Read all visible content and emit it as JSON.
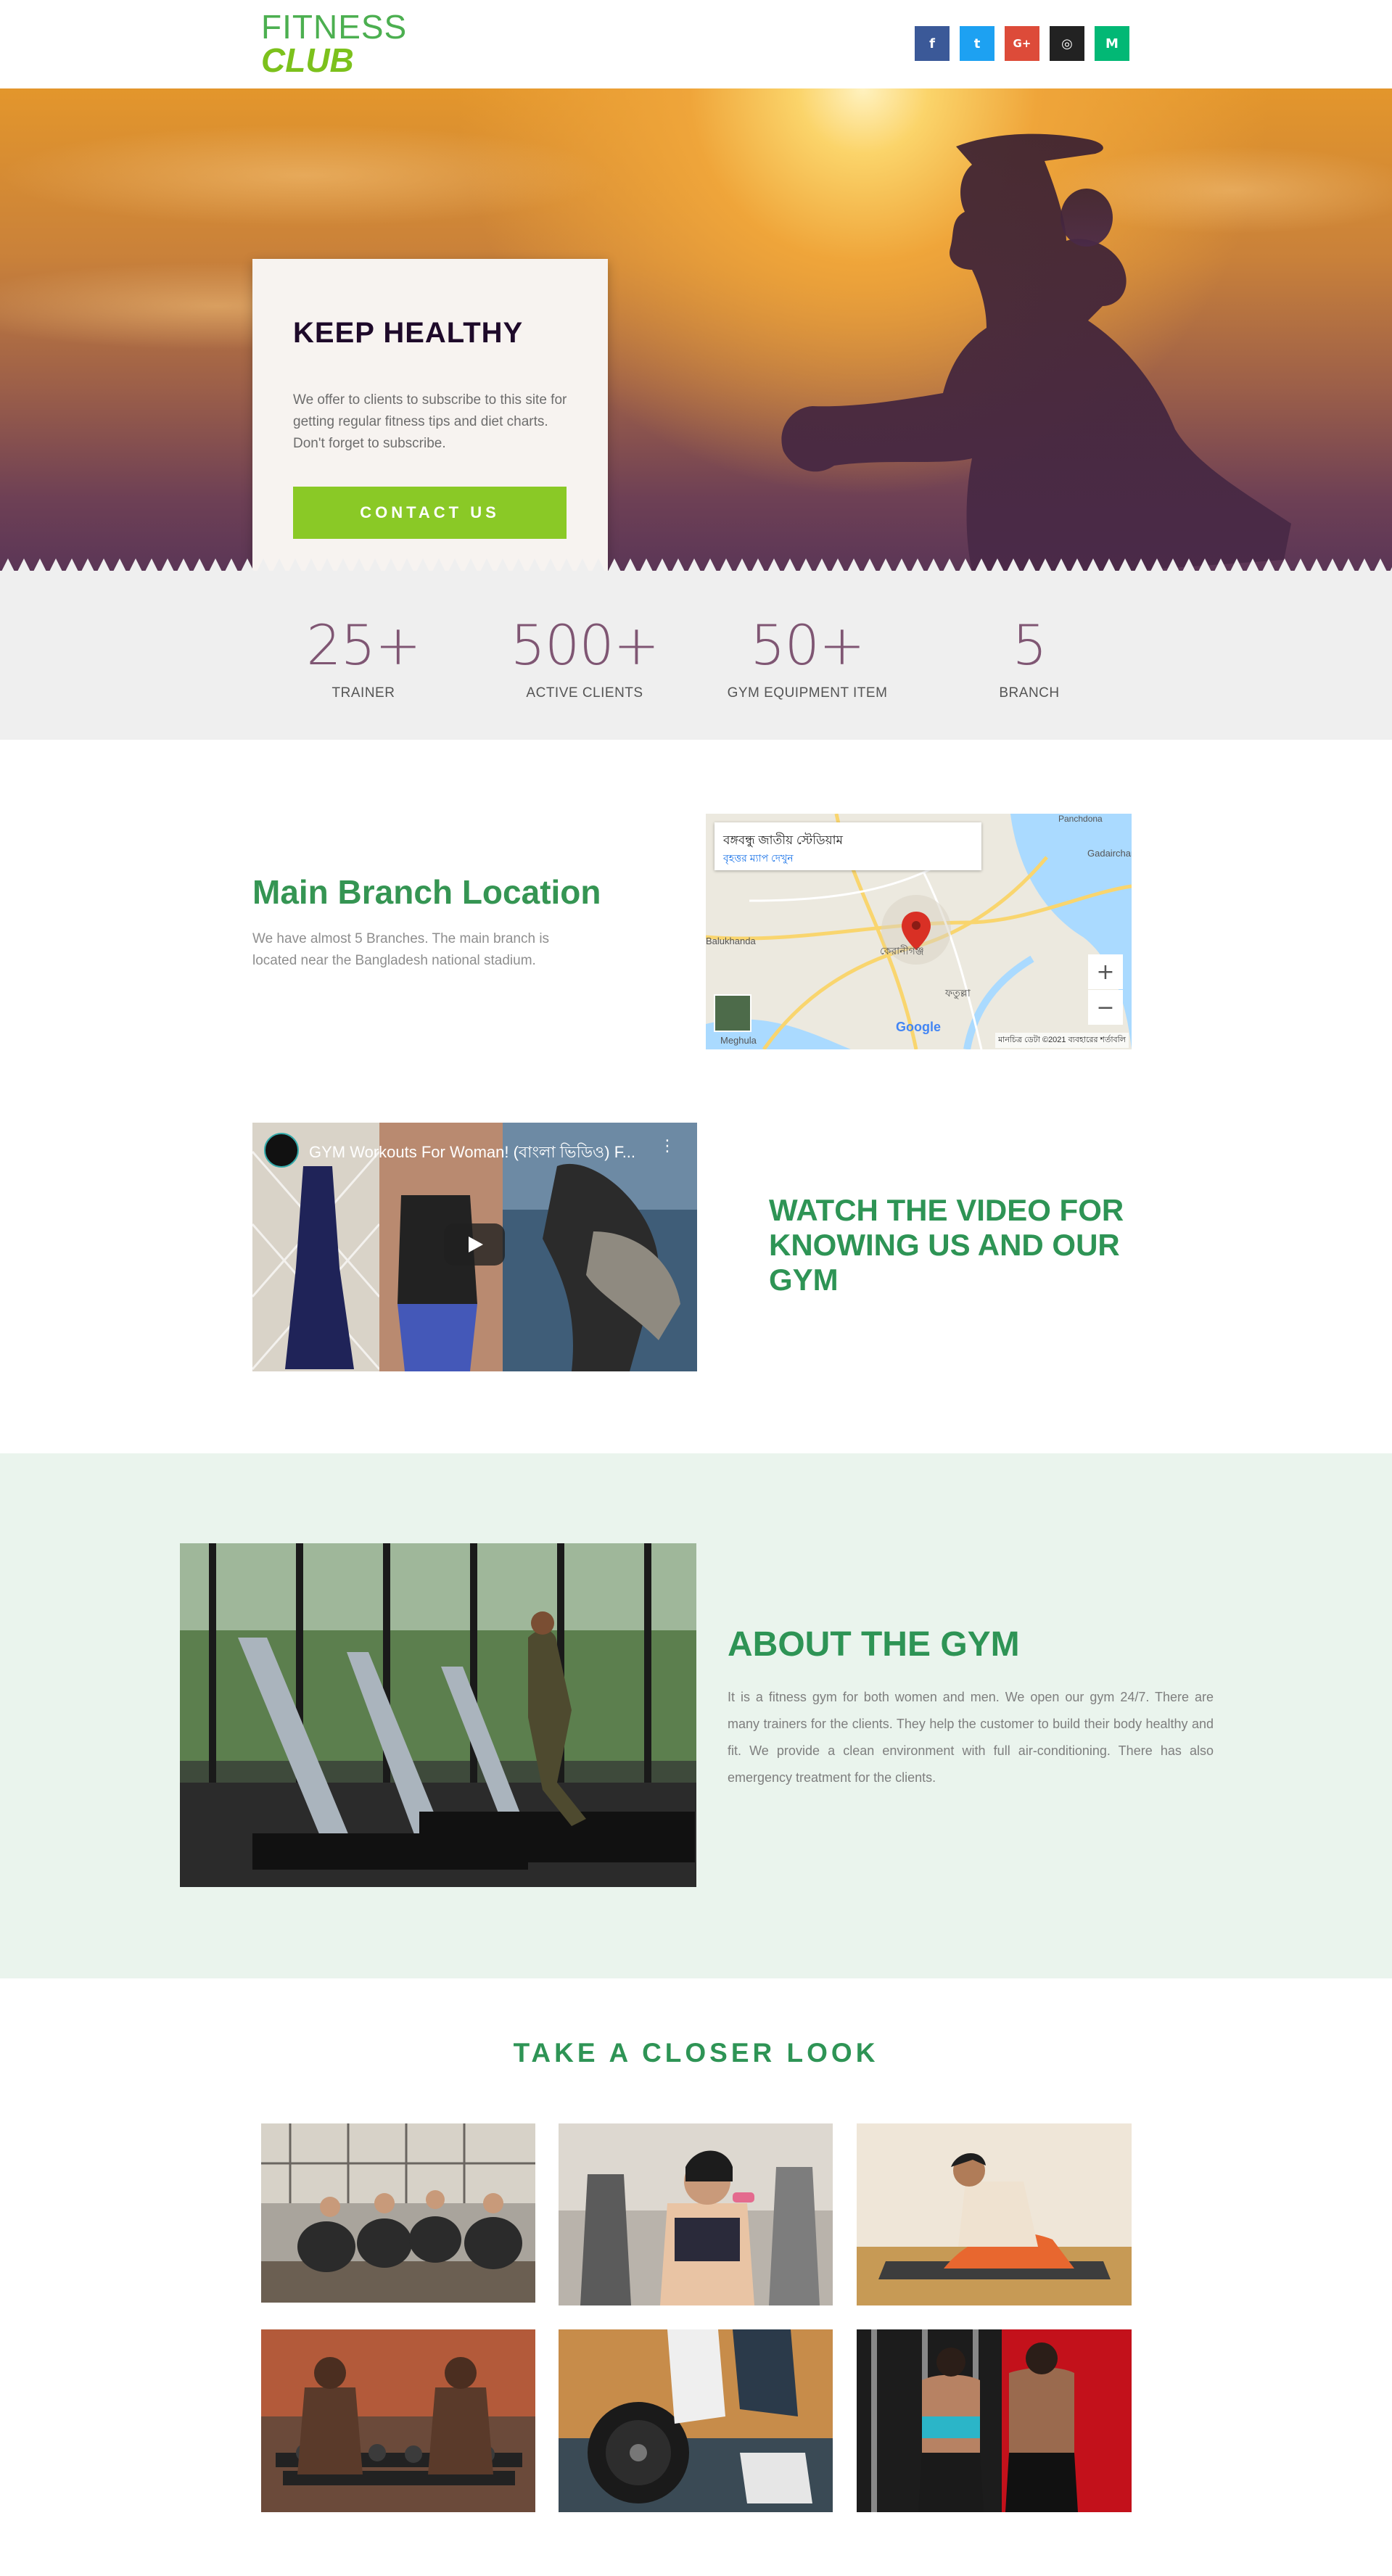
{
  "header": {
    "logo_line1": "FITNESS",
    "logo_line2": "CLUB",
    "socials": [
      {
        "icon": "facebook-icon",
        "glyph": "f",
        "color": "#3b5998"
      },
      {
        "icon": "twitter-icon",
        "glyph": "t",
        "color": "#1da1f2"
      },
      {
        "icon": "google-plus-icon",
        "glyph": "G+",
        "color": "#dd4b39"
      },
      {
        "icon": "instagram-icon",
        "glyph": "◎",
        "color": "#222222"
      },
      {
        "icon": "medium-icon",
        "glyph": "M",
        "color": "#02b875"
      }
    ]
  },
  "hero": {
    "title": "KEEP HEALTHY",
    "text": "We offer to clients to subscribe to this site for getting regular fitness tips and diet charts. Don't forget to subscribe.",
    "button": "CONTACT US"
  },
  "stats": [
    {
      "value": "25+",
      "label": "TRAINER"
    },
    {
      "value": "500+",
      "label": "ACTIVE CLIENTS"
    },
    {
      "value": "50+",
      "label": "GYM EQUIPMENT ITEM"
    },
    {
      "value": "5",
      "label": "BRANCH"
    }
  ],
  "location": {
    "title": "Main Branch Location",
    "text": "We have almost 5 Branches. The main branch is located near the Bangladesh national stadium.",
    "map_place": "বঙ্গবন্ধু জাতীয় স্টেডিয়াম",
    "map_link": "বৃহত্তর ম্যাপ দেখুন",
    "map_labels": [
      "Gadairchar",
      "Balukhanda",
      "কেরানীগঞ্জ",
      "ফতুল্লা",
      "Meghula",
      "Panchdona"
    ],
    "map_google": "Google",
    "map_footer": "মানচিত্র ডেটা ©2021   ব্যবহারের শর্তাবলি"
  },
  "video": {
    "title": "GYM Workouts For Woman! (বাংলা ভিডিও) F...",
    "headline": "WATCH THE VIDEO FOR KNOWING US AND OUR GYM"
  },
  "about": {
    "title": "ABOUT THE GYM",
    "text": "It is a fitness gym for both women and men. We open our gym 24/7. There are many trainers for the clients. They help the customer to build their body healthy and fit. We provide a clean environment with full air-conditioning. There has also emergency treatment for the clients."
  },
  "gallery": {
    "title": "TAKE A CLOSER LOOK"
  },
  "colors": {
    "brand_green": "#2e9455",
    "accent_lime": "#8ac926",
    "stat_purple": "#7f5673"
  }
}
